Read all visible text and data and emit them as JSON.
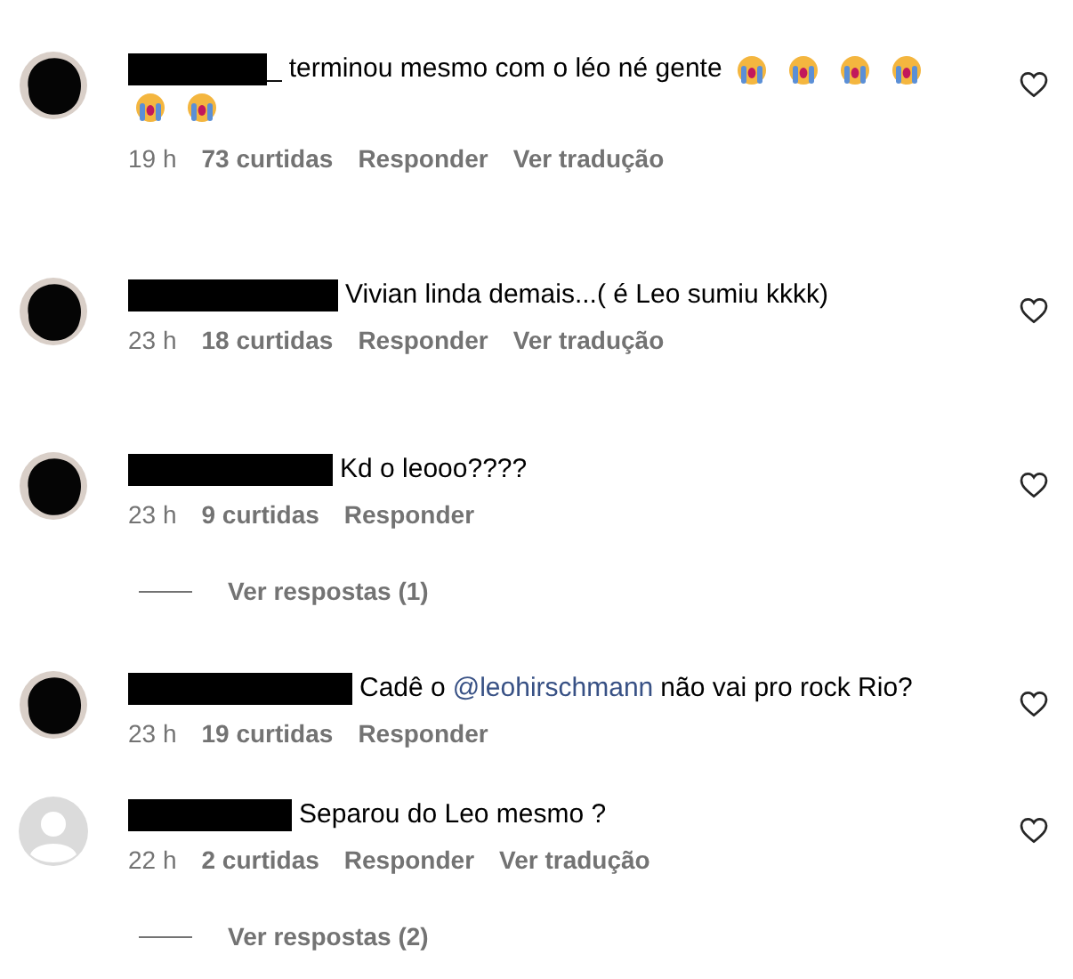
{
  "comments": [
    {
      "avatar": {
        "kind": "scribbled"
      },
      "name_fragment": "_",
      "text": [
        {
          "kind": "plain",
          "value": "terminou mesmo com o léo né gente"
        }
      ],
      "emojis": [
        {
          "kind": "sob"
        },
        {
          "kind": "sob"
        },
        {
          "kind": "sob"
        },
        {
          "kind": "sob"
        },
        {
          "kind": "sob"
        },
        {
          "kind": "sob"
        }
      ],
      "time": "19 h",
      "likes": "73 curtidas",
      "reply": "Responder",
      "translate": "Ver tradução",
      "liked": false
    },
    {
      "avatar": {
        "kind": "scribbled"
      },
      "text": [
        {
          "kind": "plain",
          "value": "Vivian linda demais...( é Leo sumiu kkkk)"
        }
      ],
      "time": "23 h",
      "likes": "18 curtidas",
      "reply": "Responder",
      "translate": "Ver tradução",
      "liked": false
    },
    {
      "avatar": {
        "kind": "scribbled"
      },
      "text": [
        {
          "kind": "plain",
          "value": "Kd o leooo????"
        }
      ],
      "time": "23 h",
      "likes": "9 curtidas",
      "reply": "Responder",
      "liked": false,
      "replies": "Ver respostas (1)"
    },
    {
      "avatar": {
        "kind": "scribbled"
      },
      "text": [
        {
          "kind": "plain",
          "value": "Cadê o"
        },
        {
          "kind": "mention",
          "value": "@leohirschmann"
        },
        {
          "kind": "plain",
          "value": "não vai pro rock Rio?"
        }
      ],
      "time": "23 h",
      "likes": "19 curtidas",
      "reply": "Responder",
      "liked": false
    },
    {
      "avatar": {
        "kind": "default"
      },
      "text": [
        {
          "kind": "plain",
          "value": "Separou do Leo mesmo ?"
        }
      ],
      "time": "22 h",
      "likes": "2 curtidas",
      "reply": "Responder",
      "translate": "Ver tradução",
      "liked": false,
      "replies": "Ver respostas (2)"
    }
  ]
}
